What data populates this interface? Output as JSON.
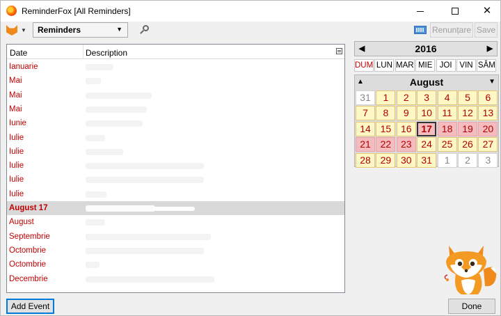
{
  "window": {
    "title": "ReminderFox [All Reminders]"
  },
  "toolbar": {
    "list_selected": "Reminders",
    "cancel_label": "Renunțare",
    "save_label": "Save",
    "icons": [
      "fox-menu-icon",
      "search-icon",
      "keyboard-icon"
    ]
  },
  "list": {
    "headers": {
      "date": "Date",
      "description": "Description"
    },
    "rows": [
      {
        "date": "Ianuarie",
        "selected": false
      },
      {
        "date": "Mai",
        "selected": false
      },
      {
        "date": "Mai",
        "selected": false
      },
      {
        "date": "Mai",
        "selected": false
      },
      {
        "date": "Iunie",
        "selected": false
      },
      {
        "date": "Iulie",
        "selected": false
      },
      {
        "date": "Iulie",
        "selected": false
      },
      {
        "date": "Iulie",
        "selected": false
      },
      {
        "date": "Iulie",
        "selected": false
      },
      {
        "date": "Iulie",
        "selected": false
      },
      {
        "date": "August 17",
        "selected": true
      },
      {
        "date": "August",
        "selected": false
      },
      {
        "date": "Septembrie",
        "selected": false
      },
      {
        "date": "Octombrie",
        "selected": false
      },
      {
        "date": "Octombrie",
        "selected": false
      },
      {
        "date": "Decembrie",
        "selected": false
      }
    ]
  },
  "calendar": {
    "year": "2016",
    "month": "August",
    "weekdays": [
      "DUM",
      "LUN",
      "MAR",
      "MIE",
      "JOI",
      "VIN",
      "SÂM"
    ],
    "weeks": [
      [
        "31",
        "1",
        "2",
        "3",
        "4",
        "5",
        "6"
      ],
      [
        "7",
        "8",
        "9",
        "10",
        "11",
        "12",
        "13"
      ],
      [
        "14",
        "15",
        "16",
        "17",
        "18",
        "19",
        "20"
      ],
      [
        "21",
        "22",
        "23",
        "24",
        "25",
        "26",
        "27"
      ],
      [
        "28",
        "29",
        "30",
        "31",
        "1",
        "2",
        "3"
      ]
    ],
    "today": "17",
    "event_days": [
      "18",
      "19",
      "20",
      "21",
      "22",
      "23"
    ],
    "colors": {
      "weekday_fill": "#fff8c4",
      "event_fill": "#f5bcc0",
      "date_text": "#b00000"
    }
  },
  "footer": {
    "add_label": "Add Event",
    "done_label": "Done"
  }
}
